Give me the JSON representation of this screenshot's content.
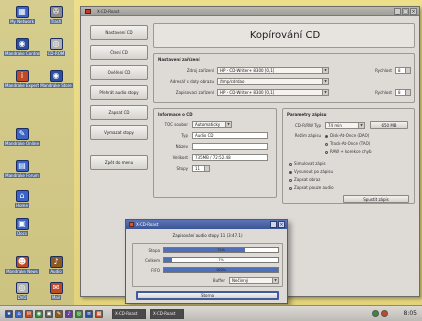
{
  "desktop": {
    "icons": [
      {
        "name": "desk-icon-0",
        "label": "My Network",
        "glyph": "▦",
        "color": "#3a64c8"
      },
      {
        "name": "desk-icon-1",
        "label": "Trash",
        "glyph": "✇",
        "color": "#8a8a8a"
      },
      {
        "name": "desk-icon-2",
        "label": "Mandrake Control Center",
        "glyph": "◉",
        "color": "#2d4fa0"
      },
      {
        "name": "desk-icon-3",
        "label": "CD-ROM",
        "glyph": "◎",
        "color": "#b0b0b0"
      },
      {
        "name": "desk-icon-4",
        "label": "Mandrake Expert",
        "glyph": "i",
        "color": "#c04a24"
      },
      {
        "name": "desk-icon-5",
        "label": "Mandrake Store",
        "glyph": "◉",
        "color": "#2d4fa0"
      },
      {
        "name": "desk-icon-6",
        "label": "Mandrake Online",
        "glyph": "✎",
        "color": "#3a64c8"
      },
      {
        "name": "desk-icon-7",
        "label": "Mandrake Forum",
        "glyph": "▤",
        "color": "#3a64c8"
      },
      {
        "name": "desk-icon-8",
        "label": "Home",
        "glyph": "⌂",
        "color": "#3a64c8"
      },
      {
        "name": "desk-icon-9",
        "label": "Docs",
        "glyph": "▣",
        "color": "#3a64c8"
      },
      {
        "name": "desk-icon-10",
        "label": "Mandrake News",
        "glyph": "☻",
        "color": "#c04a24"
      },
      {
        "name": "desk-icon-11",
        "label": "Audio",
        "glyph": "♪",
        "color": "#8a5a20"
      },
      {
        "name": "desk-icon-12",
        "label": "DVD",
        "glyph": "◎",
        "color": "#b0b0b0"
      },
      {
        "name": "desk-icon-13",
        "label": "Mail",
        "glyph": "✉",
        "color": "#c04a24"
      }
    ]
  },
  "window": {
    "title": "X-CD-Roast",
    "buttons": {
      "minimize": "_",
      "maximize": "□",
      "close": "×"
    }
  },
  "sidebar": {
    "buttons": [
      {
        "name": "sidebar-btn-nastaveni",
        "label": "Nastavení CD"
      },
      {
        "name": "sidebar-btn-cteni",
        "label": "Čtení CD"
      },
      {
        "name": "sidebar-btn-overeni",
        "label": "Ověření CD"
      },
      {
        "name": "sidebar-btn-prehrat",
        "label": "Přehrát audio stopy"
      },
      {
        "name": "sidebar-btn-zapsat",
        "label": "Zapsat CD"
      },
      {
        "name": "sidebar-btn-vymazat",
        "label": "Vymazat stopy"
      },
      {
        "name": "sidebar-btn-zpet",
        "label": "Zpět do menu"
      }
    ]
  },
  "main": {
    "title": "Kopírování CD",
    "devices": {
      "heading": "Nastavení zařízení",
      "rows": [
        {
          "label": "Zdroj zařízení",
          "value": "HP  -  CD-Writer+ 8300  [0,1]",
          "extra": "Rychlost",
          "extra_value": "8"
        },
        {
          "label": "Adresář s daty obrazu",
          "value": "/tmp/cdrdao",
          "extra": "",
          "extra_value": ""
        },
        {
          "label": "Zapisovací zařízení",
          "value": "HP  -  CD-Writer+ 8300  [0,1]",
          "extra": "Rychlost",
          "extra_value": "8"
        }
      ]
    },
    "info": {
      "heading": "Informace o CD",
      "rows": [
        {
          "label": "TOC soubor",
          "value": "Automaticky"
        },
        {
          "label": "Typ",
          "value": "Audio CD"
        },
        {
          "label": "Název",
          "value": ""
        },
        {
          "label": "Velikost",
          "value": "735MB / 72:52.48"
        },
        {
          "label": "Stopy",
          "value": "11"
        }
      ]
    },
    "write": {
      "heading": "Parametry zápisu",
      "disc_type_label": "CD-R/RW Typ",
      "disc_type_value": "74 min",
      "disc_size_value": "650 MB",
      "mode_label": "Režim zápisu",
      "modes": [
        {
          "label": "Disk-At-Once (DAO)",
          "checked": true
        },
        {
          "label": "Track-At-Once (TAO)",
          "checked": false
        },
        {
          "label": "RAW + korekce chyb",
          "checked": false
        }
      ],
      "options": [
        {
          "label": "Simulovat zápis",
          "checked": false
        },
        {
          "label": "Vysunout po zápisu",
          "checked": true
        },
        {
          "label": "Zapsat obraz",
          "checked": false
        },
        {
          "label": "Zapsat pouze audio",
          "checked": false
        }
      ],
      "start_label": "Spustit zápis"
    }
  },
  "dialog": {
    "title": "X-CD-Roast",
    "buttons": {
      "minimize": "_",
      "close": "×"
    },
    "heading": "Zapisování audio stopy 11 (3:47.1)",
    "bars": [
      {
        "name": "progress-stopa",
        "label": "Stopa",
        "percent": 71,
        "text": "71%"
      },
      {
        "name": "progress-celkem",
        "label": "Celkem",
        "percent": 7,
        "text": "7%"
      },
      {
        "name": "progress-fifo",
        "label": "FIFO",
        "percent": 100,
        "text": "100%"
      }
    ],
    "buffer_label": "Buffer",
    "buffer_value": "Nečinný",
    "cancel_label": "Storno"
  },
  "taskbar": {
    "launchers": [
      {
        "name": "tb-launch-0",
        "glyph": "★",
        "color": "#2d4fa0"
      },
      {
        "name": "tb-launch-1",
        "glyph": "⌂",
        "color": "#3a64c8"
      },
      {
        "name": "tb-launch-2",
        "glyph": "✉",
        "color": "#c04a24"
      },
      {
        "name": "tb-launch-3",
        "glyph": "◉",
        "color": "#3a8a3a"
      },
      {
        "name": "tb-launch-4",
        "glyph": "▣",
        "color": "#5a5a5a"
      },
      {
        "name": "tb-launch-5",
        "glyph": "✎",
        "color": "#8a5a20"
      },
      {
        "name": "tb-launch-6",
        "glyph": "♪",
        "color": "#6a3a9a"
      },
      {
        "name": "tb-launch-7",
        "glyph": "◎",
        "color": "#3a8a3a"
      },
      {
        "name": "tb-launch-8",
        "glyph": "≡",
        "color": "#2d4fa0"
      },
      {
        "name": "tb-launch-9",
        "glyph": "▦",
        "color": "#c04a24"
      }
    ],
    "tasks": [
      {
        "name": "tb-task-xcdroast",
        "label": "X-CD-Roast"
      },
      {
        "name": "tb-task-term",
        "label": "X-CD-Roast"
      }
    ],
    "tray": [
      {
        "name": "tray-icon-0",
        "color": "#3a8a3a"
      },
      {
        "name": "tray-icon-1",
        "color": "#c04a24"
      }
    ],
    "clock": "8:05"
  }
}
